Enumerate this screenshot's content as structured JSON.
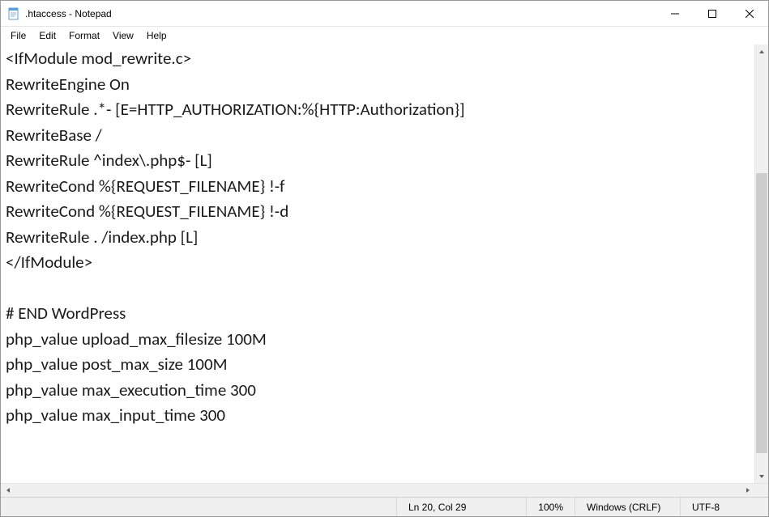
{
  "window": {
    "title": ".htaccess - Notepad"
  },
  "menu": {
    "file": "File",
    "edit": "Edit",
    "format": "Format",
    "view": "View",
    "help": "Help"
  },
  "editor": {
    "content": "<IfModule mod_rewrite.c>\nRewriteEngine On\nRewriteRule .*- [E=HTTP_AUTHORIZATION:%{HTTP:Authorization}]\nRewriteBase /\nRewriteRule ^index\\.php$- [L]\nRewriteCond %{REQUEST_FILENAME} !-f\nRewriteCond %{REQUEST_FILENAME} !-d\nRewriteRule . /index.php [L]\n</IfModule>\n\n# END WordPress\nphp_value upload_max_filesize 100M\nphp_value post_max_size 100M\nphp_value max_execution_time 300\nphp_value max_input_time 300"
  },
  "status": {
    "position": "Ln 20, Col 29",
    "zoom": "100%",
    "line_ending": "Windows (CRLF)",
    "encoding": "UTF-8"
  }
}
